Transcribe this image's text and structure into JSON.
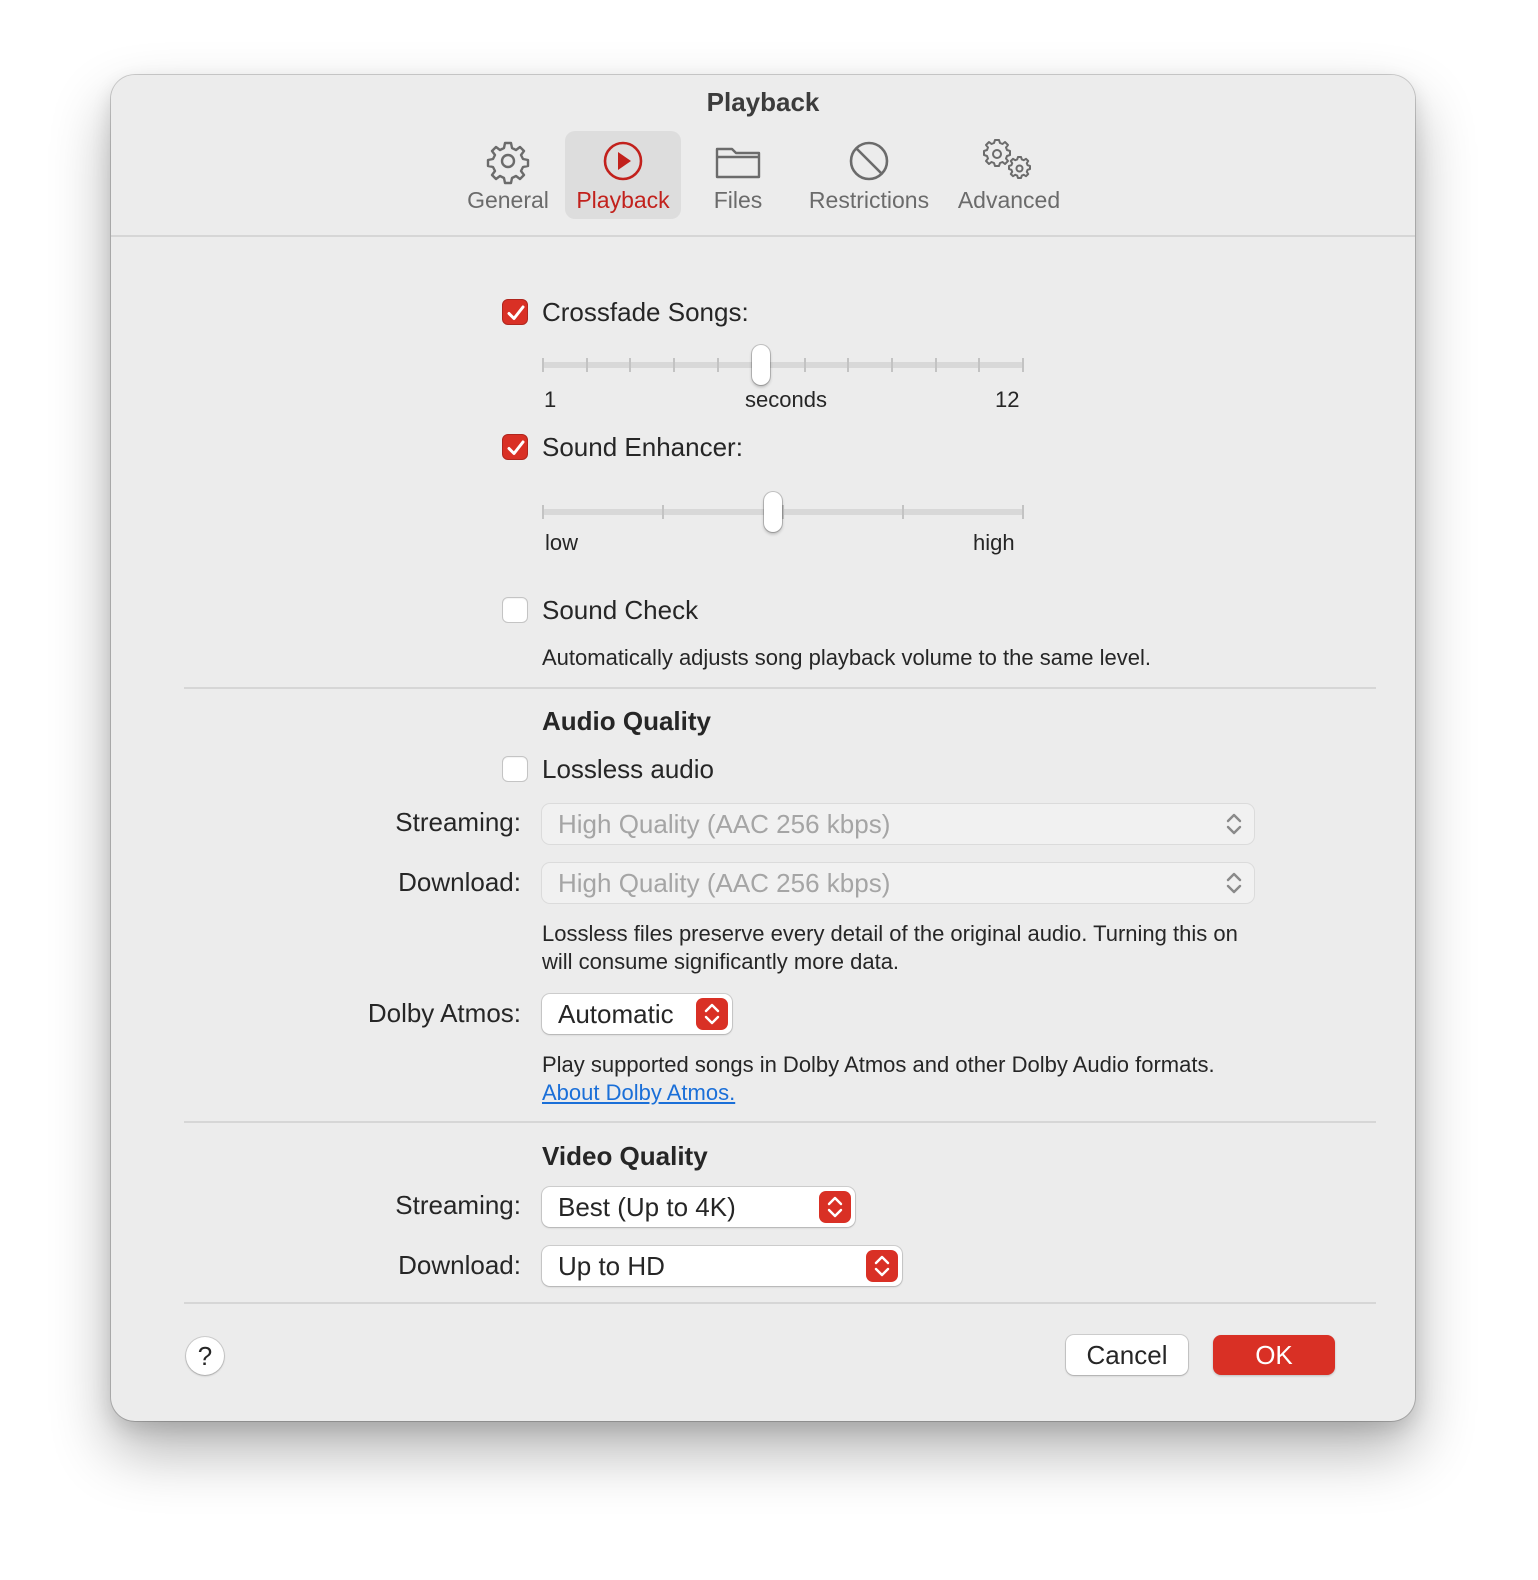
{
  "window": {
    "title": "Playback"
  },
  "tabs": [
    {
      "label": "General",
      "icon": "gear-icon"
    },
    {
      "label": "Playback",
      "icon": "play-circle-icon",
      "active": true
    },
    {
      "label": "Files",
      "icon": "folder-icon"
    },
    {
      "label": "Restrictions",
      "icon": "restricted-icon"
    },
    {
      "label": "Advanced",
      "icon": "gears-icon"
    }
  ],
  "playback": {
    "crossfade": {
      "label": "Crossfade Songs:",
      "checked": true,
      "min_label": "1",
      "unit_label": "seconds",
      "max_label": "12",
      "min": 1,
      "max": 12,
      "value": 6
    },
    "sound_enhancer": {
      "label": "Sound Enhancer:",
      "checked": true,
      "min_label": "low",
      "max_label": "high",
      "steps": 5,
      "value_fraction": 0.48
    },
    "sound_check": {
      "label": "Sound Check",
      "checked": false,
      "description": "Automatically adjusts song playback volume to the same level."
    }
  },
  "audio_quality": {
    "header": "Audio Quality",
    "lossless": {
      "label": "Lossless audio",
      "checked": false
    },
    "streaming": {
      "label": "Streaming:",
      "value": "High Quality (AAC 256 kbps)",
      "enabled": false
    },
    "download": {
      "label": "Download:",
      "value": "High Quality (AAC 256 kbps)",
      "enabled": false
    },
    "lossless_note_1": "Lossless files preserve every detail of the original audio. Turning this on",
    "lossless_note_2": "will consume significantly more data.",
    "dolby": {
      "label": "Dolby Atmos:",
      "value": "Automatic"
    },
    "dolby_note": "Play supported songs in Dolby Atmos and other Dolby Audio formats.",
    "dolby_link": "About Dolby Atmos."
  },
  "video_quality": {
    "header": "Video Quality",
    "streaming": {
      "label": "Streaming:",
      "value": "Best (Up to 4K)"
    },
    "download": {
      "label": "Download:",
      "value": "Up to HD"
    }
  },
  "footer": {
    "help_label": "?",
    "cancel_label": "Cancel",
    "ok_label": "OK"
  },
  "colors": {
    "accent": "#d93025",
    "window_bg": "#ececec",
    "link": "#1a6fd8"
  }
}
